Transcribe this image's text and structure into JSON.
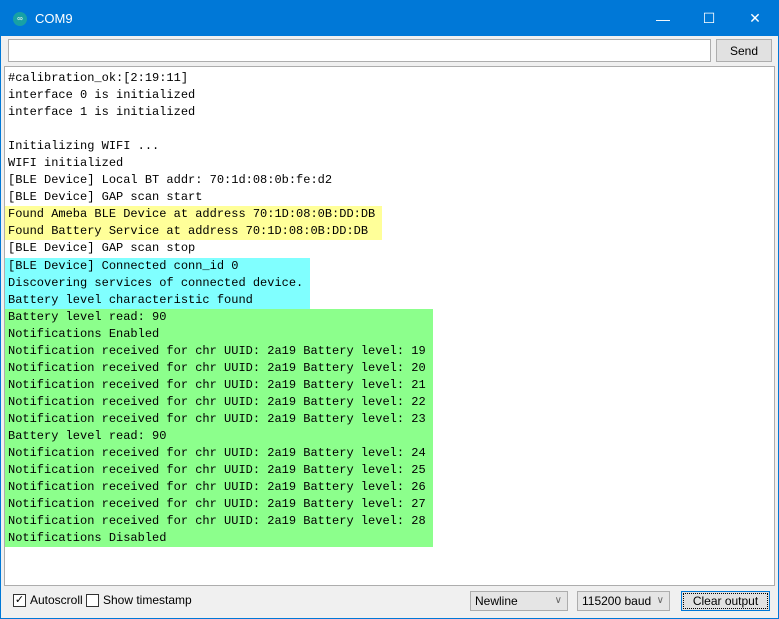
{
  "window": {
    "title": "COM9"
  },
  "input": {
    "value": "",
    "send_label": "Send"
  },
  "output": {
    "groups": [
      {
        "color": "#ffffff",
        "lines": [
          "#calibration_ok:[2:19:11]",
          "interface 0 is initialized",
          "interface 1 is initialized",
          "",
          "Initializing WIFI ...",
          "WIFI initialized",
          "[BLE Device] Local BT addr: 70:1d:08:0b:fe:d2",
          "[BLE Device] GAP scan start"
        ]
      },
      {
        "color": "#ffff99",
        "lines": [
          "Found Ameba BLE Device at address 70:1D:08:0B:DD:DB",
          "Found Battery Service at address 70:1D:08:0B:DD:DB"
        ]
      },
      {
        "color": "#ffffff",
        "lines": [
          "[BLE Device] GAP scan stop"
        ]
      },
      {
        "color": "#80ffff",
        "lines": [
          "[BLE Device] Connected conn_id 0",
          "Discovering services of connected device.",
          "Battery level characteristic found"
        ]
      },
      {
        "color": "#8cff8c",
        "lines": [
          "Battery level read: 90",
          "Notifications Enabled",
          "Notification received for chr UUID: 2a19 Battery level: 19",
          "Notification received for chr UUID: 2a19 Battery level: 20",
          "Notification received for chr UUID: 2a19 Battery level: 21",
          "Notification received for chr UUID: 2a19 Battery level: 22",
          "Notification received for chr UUID: 2a19 Battery level: 23",
          "Battery level read: 90",
          "Notification received for chr UUID: 2a19 Battery level: 24",
          "Notification received for chr UUID: 2a19 Battery level: 25",
          "Notification received for chr UUID: 2a19 Battery level: 26",
          "Notification received for chr UUID: 2a19 Battery level: 27",
          "Notification received for chr UUID: 2a19 Battery level: 28",
          "Notifications Disabled"
        ]
      }
    ]
  },
  "footer": {
    "autoscroll_label": "Autoscroll",
    "autoscroll_checked": true,
    "timestamp_label": "Show timestamp",
    "timestamp_checked": false,
    "line_ending": "Newline",
    "baud": "115200 baud",
    "clear_label": "Clear output"
  }
}
